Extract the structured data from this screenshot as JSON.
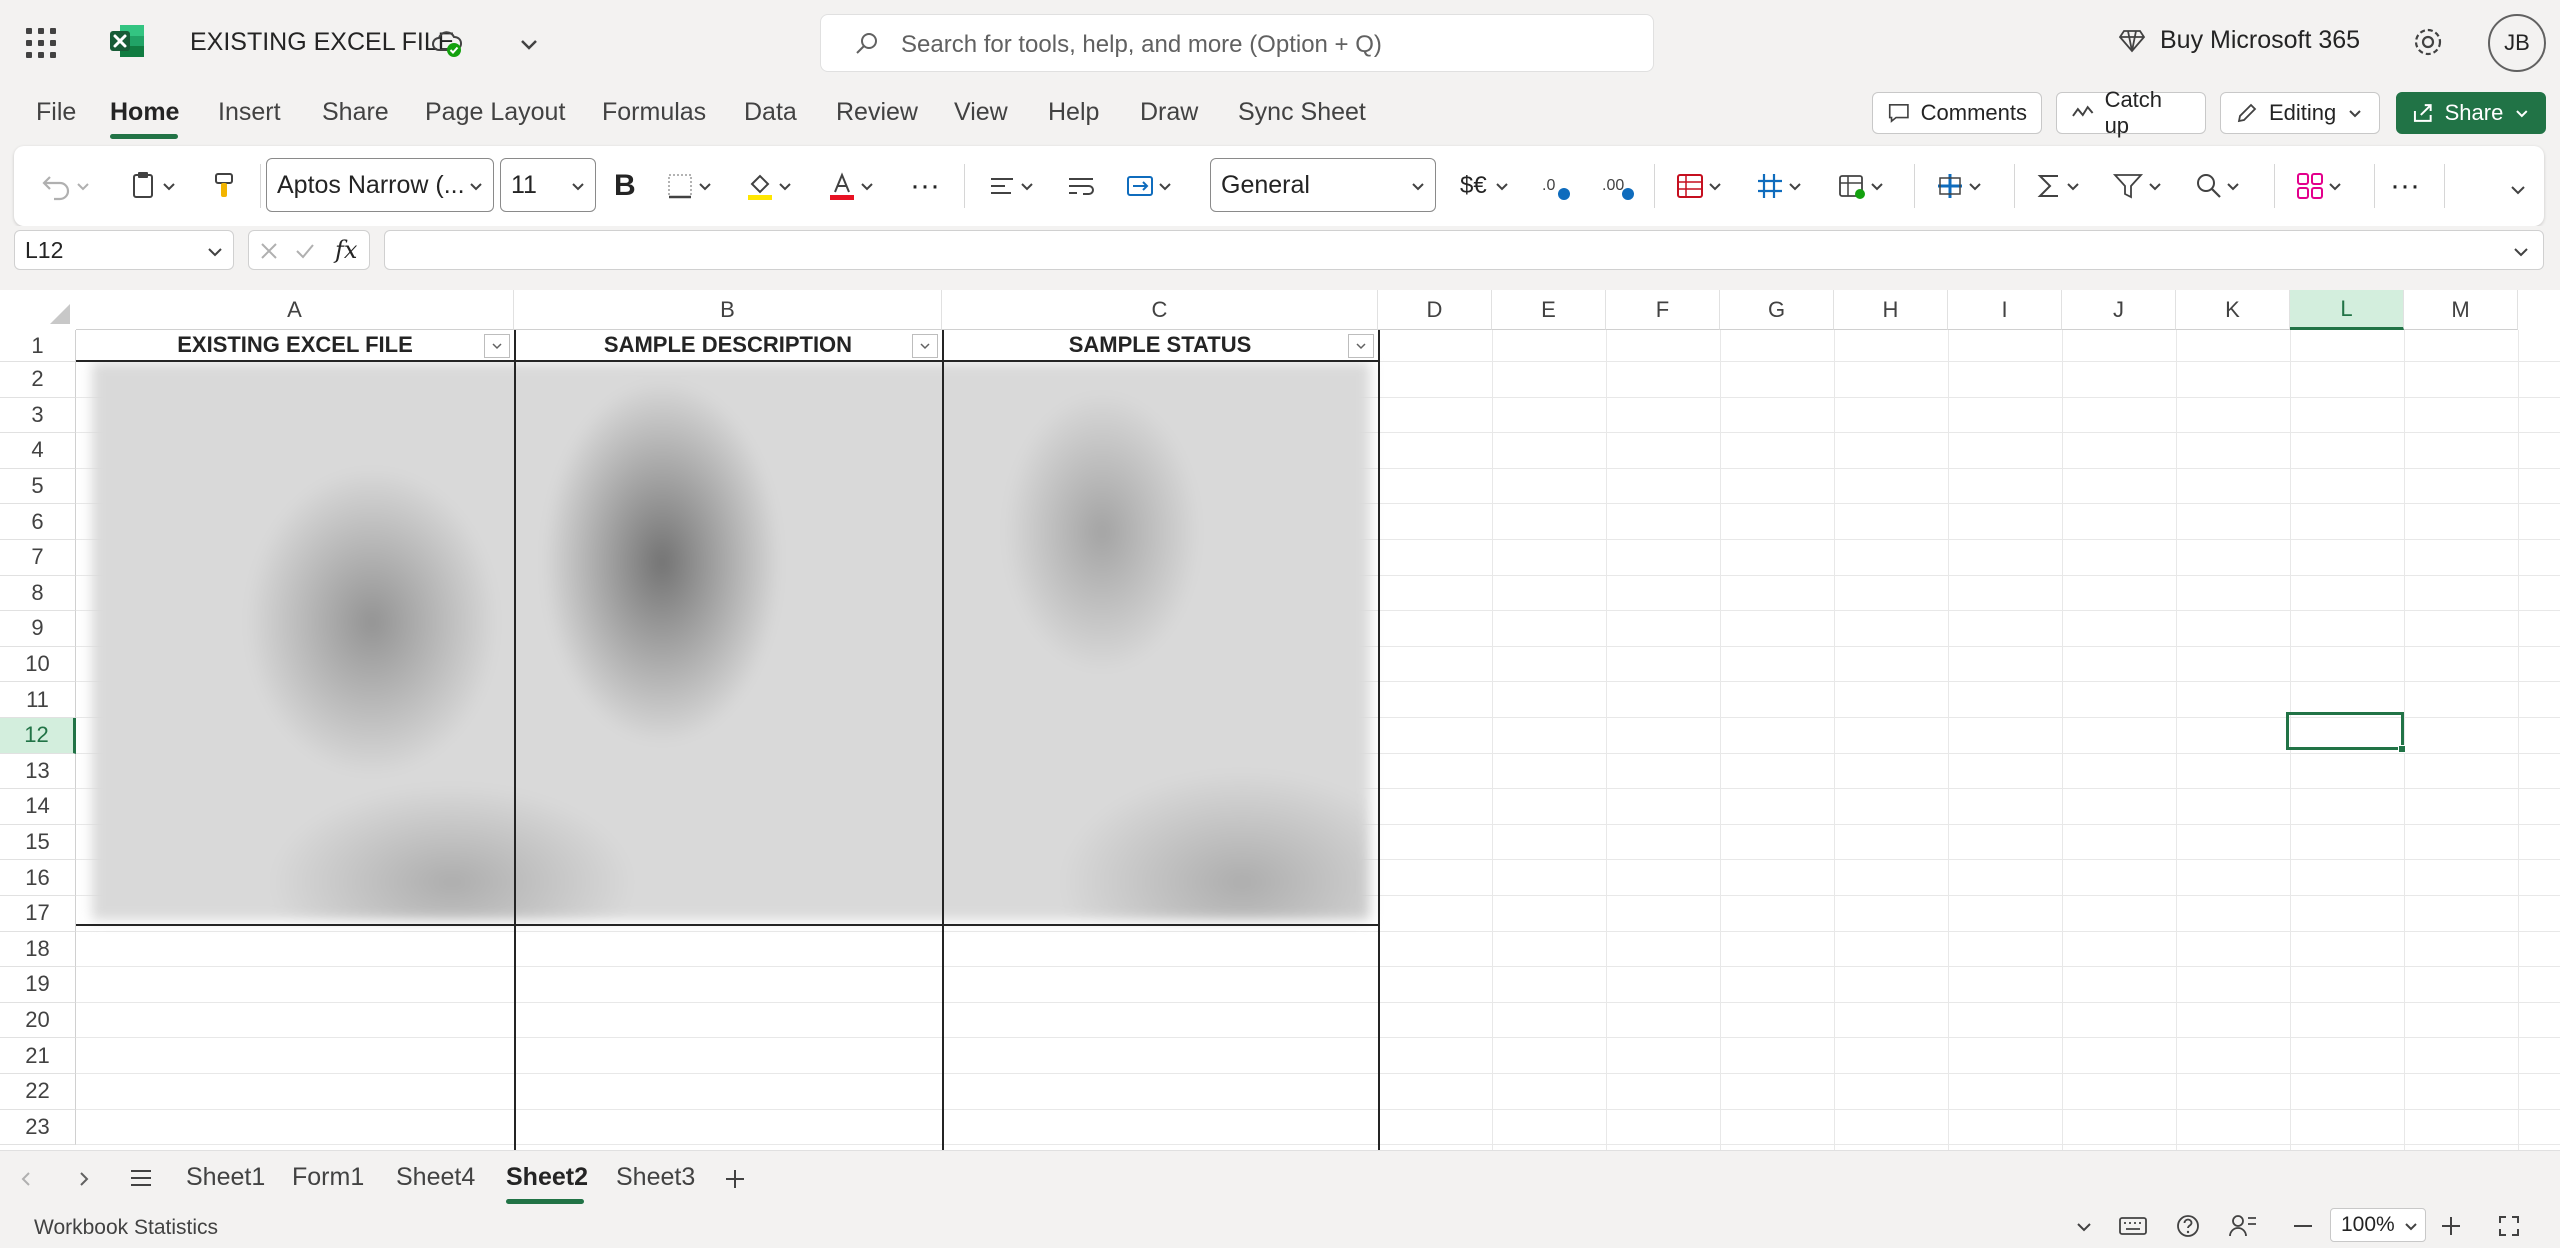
{
  "app": {
    "doc_title": "EXISTING EXCEL FILE",
    "buy_label": "Buy Microsoft 365",
    "avatar_initials": "JB",
    "accent": "#217346"
  },
  "search": {
    "placeholder": "Search for tools, help, and more (Option + Q)"
  },
  "menu_tabs": [
    "File",
    "Home",
    "Insert",
    "Share",
    "Page Layout",
    "Formulas",
    "Data",
    "Review",
    "View",
    "Help",
    "Draw",
    "Sync Sheet"
  ],
  "active_tab": "Home",
  "actions": {
    "comments": "Comments",
    "catch_up": "Catch up",
    "editing": "Editing",
    "share": "Share"
  },
  "ribbon": {
    "font_name": "Aptos Narrow (...",
    "font_size": "11",
    "number_format": "General",
    "bold_label": "B",
    "currency_label": "$€"
  },
  "formula_bar": {
    "name_box": "L12",
    "fx_label": "fx",
    "content": ""
  },
  "columns": [
    "A",
    "B",
    "C",
    "D",
    "E",
    "F",
    "G",
    "H",
    "I",
    "J",
    "K",
    "L",
    "M"
  ],
  "rows": [
    "1",
    "2",
    "3",
    "4",
    "5",
    "6",
    "7",
    "8",
    "9",
    "10",
    "11",
    "12",
    "13",
    "14",
    "15",
    "16",
    "17",
    "18",
    "19",
    "20",
    "21",
    "22",
    "23"
  ],
  "selected_cell": {
    "column": "L",
    "row": "12"
  },
  "table": {
    "headers": [
      "EXISTING EXCEL FILE",
      "SAMPLE DESCRIPTION",
      "SAMPLE STATUS"
    ]
  },
  "sheets": [
    "Sheet1",
    "Form1",
    "Sheet4",
    "Sheet2",
    "Sheet3"
  ],
  "active_sheet": "Sheet2",
  "status": {
    "workbook_stats": "Workbook Statistics",
    "zoom": "100%"
  }
}
